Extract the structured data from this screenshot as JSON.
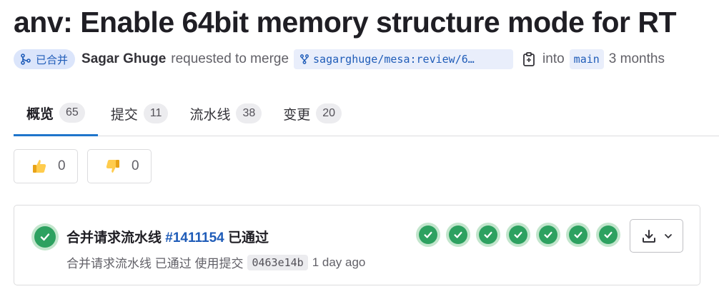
{
  "mr": {
    "title": "anv: Enable 64bit memory structure mode for RT",
    "status": "已合并",
    "author": "Sagar Ghuge",
    "action": "requested to merge",
    "source_branch": "sagarghuge/mesa:review/6…",
    "into": "into",
    "target_branch": "main",
    "time": "3 months"
  },
  "tabs": [
    {
      "label": "概览",
      "count": "65"
    },
    {
      "label": "提交",
      "count": "11"
    },
    {
      "label": "流水线",
      "count": "38"
    },
    {
      "label": "变更",
      "count": "20"
    }
  ],
  "reactions": {
    "thumbs_up": {
      "icon": "thumbs-up-icon",
      "count": "0"
    },
    "thumbs_down": {
      "icon": "thumbs-down-icon",
      "count": "0"
    }
  },
  "pipeline": {
    "title_prefix": "合并请求流水线",
    "id": "#1411154",
    "title_suffix": "已通过",
    "sub_text": "合并请求流水线 已通过 使用提交",
    "commit_sha": "0463e14b",
    "time": "1 day ago",
    "stage_count": 7,
    "stage_status": "passed"
  },
  "colors": {
    "accent": "#1f75cb",
    "link": "#1f5cb8",
    "success": "#2da160",
    "badge_bg": "#dbe5fb"
  }
}
